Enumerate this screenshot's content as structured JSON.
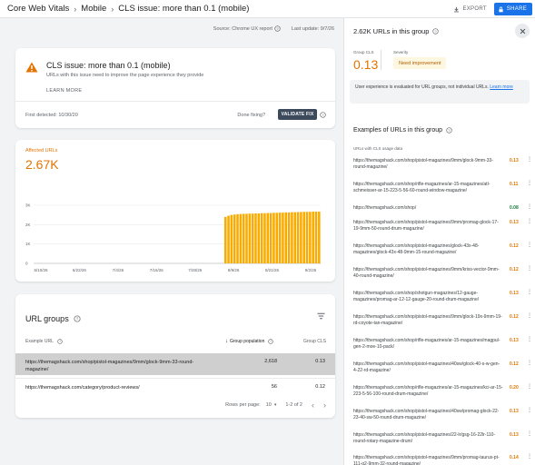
{
  "breadcrumb": [
    "Core Web Vitals",
    "Mobile",
    "CLS issue: more than 0.1 (mobile)"
  ],
  "header": {
    "export_label": "EXPORT",
    "share_label": "SHARE"
  },
  "source": {
    "label": "Source: Chrome UX report",
    "last_update": "Last update: 9/7/26"
  },
  "issue": {
    "title": "CLS issue: more than 0.1 (mobile)",
    "description": "URLs with this issue need to improve the page experience they provide",
    "learn_more": "LEARN MORE",
    "first_detected": "First detected: 10/30/20",
    "done_fixing": "Done fixing?",
    "validate_label": "VALIDATE FIX",
    "icon": "warning-icon",
    "accent": "#e37400"
  },
  "affected": {
    "label": "Affected URLs",
    "value": "2.67K"
  },
  "chart_data": {
    "type": "bar",
    "ylim": [
      0,
      3000
    ],
    "y_ticks": [
      "3K",
      "2K",
      "1K",
      "0"
    ],
    "x_ticks": [
      "6/10/26",
      "6/22/26",
      "7/4/26",
      "7/16/26",
      "7/28/26",
      "8/9/26",
      "8/21/26",
      "9/2/26"
    ],
    "color": "#f9ab00",
    "values": [
      0,
      0,
      0,
      0,
      0,
      0,
      0,
      0,
      0,
      0,
      0,
      0,
      0,
      0,
      0,
      0,
      0,
      0,
      0,
      0,
      0,
      0,
      0,
      0,
      0,
      0,
      0,
      0,
      0,
      0,
      0,
      0,
      0,
      0,
      0,
      0,
      0,
      0,
      0,
      0,
      0,
      0,
      0,
      0,
      0,
      0,
      0,
      0,
      0,
      0,
      0,
      0,
      0,
      0,
      0,
      0,
      0,
      0,
      0,
      0,
      0,
      0,
      0,
      2400,
      2460,
      2500,
      2520,
      2540,
      2550,
      2560,
      2560,
      2570,
      2570,
      2580,
      2580,
      2590,
      2590,
      2600,
      2600,
      2610,
      2610,
      2620,
      2620,
      2630,
      2630,
      2640,
      2640,
      2650,
      2650,
      2660,
      2660,
      2660,
      2670,
      2670,
      2670
    ]
  },
  "groups": {
    "title": "URL groups",
    "col_url": "Example URL",
    "col_population": "Group population",
    "col_cls": "Group CLS",
    "rows": [
      {
        "url": "https://themagshack.com/shop/pistol-magazines/9mm/glock-9mm-33-round-magazine/",
        "population": "2,618",
        "cls": "0.13"
      },
      {
        "url": "https://themagshack.com/category/product-reviews/",
        "population": "56",
        "cls": "0.12"
      }
    ],
    "rows_per_page_label": "Rows per page:",
    "rows_per_page": "10",
    "range": "1-2 of 2"
  },
  "panel": {
    "title": "2.62K URLs in this group",
    "group_cls_label": "Group CLS",
    "group_cls_value": "0.13",
    "severity_label": "Severity",
    "severity_value": "Need improvement",
    "note": "User experience is evaluated for URL groups, not individual URLs.",
    "note_link": "Learn more",
    "examples_title": "Examples of URLs in this group",
    "usage_label": "URLs with CLS usage data",
    "examples": [
      {
        "url": "https://themagshack.com/shop/pistol-magazines/9mm/glock-9mm-33-round-magazine/",
        "cls": "0.13",
        "status": "poor"
      },
      {
        "url": "https://themagshack.com/shop/rifle-magazines/ar-15-magazines/atl-schmeisser-ar-15-223-5-56-60-round-window-magazine/",
        "cls": "0.11",
        "status": "poor"
      },
      {
        "url": "https://themagshack.com/shop/",
        "cls": "0.08",
        "status": "good"
      },
      {
        "url": "https://themagshack.com/shop/pistol-magazines/9mm/promag-glock-17-19-9mm-50-round-drum-magazine/",
        "cls": "0.13",
        "status": "poor"
      },
      {
        "url": "https://themagshack.com/shop/pistol-magazines/glock-43x-48-magazines/glock-43x-48-9mm-15-round-magazine/",
        "cls": "0.12",
        "status": "poor"
      },
      {
        "url": "https://themagshack.com/shop/pistol-magazines/9mm/kriss-vector-9mm-40-round-magazine/",
        "cls": "0.12",
        "status": "poor"
      },
      {
        "url": "https://themagshack.com/shop/shotgun-magazines/12-gauge-magazines/promag-ar-12-12-gauge-20-round-drum-magazine/",
        "cls": "0.13",
        "status": "poor"
      },
      {
        "url": "https://themagshack.com/shop/pistol-magazines/9mm/glock-19x-9mm-19-rd-coyote-tan-magazine/",
        "cls": "0.12",
        "status": "poor"
      },
      {
        "url": "https://themagshack.com/shop/rifle-magazines/ar-15-magazines/magpul-gen-2-moe-10-pack/",
        "cls": "0.13",
        "status": "poor"
      },
      {
        "url": "https://themagshack.com/shop/pistol-magazines/40sw/glock-40-s-w-gen-4-22-rd-magazine/",
        "cls": "0.12",
        "status": "poor"
      },
      {
        "url": "https://themagshack.com/shop/rifle-magazines/ar-15-magazines/kci-ar-15-223-5-56-100-round-drum-magazine/",
        "cls": "0.20",
        "status": "poor"
      },
      {
        "url": "https://themagshack.com/shop/pistol-magazines/40sw/promag-glock-22-23-40-sw-50-round-drum-magazine/",
        "cls": "0.13",
        "status": "poor"
      },
      {
        "url": "https://themagshack.com/shop/pistol-magazines/22-lr/gsg-16-22lr-110-round-rotary-magazine-drum/",
        "cls": "0.13",
        "status": "poor"
      },
      {
        "url": "https://themagshack.com/shop/pistol-magazines/9mm/promag-taurus-pt-111-g2-9mm-32-round-magazine/",
        "cls": "0.14",
        "status": "poor"
      }
    ]
  }
}
